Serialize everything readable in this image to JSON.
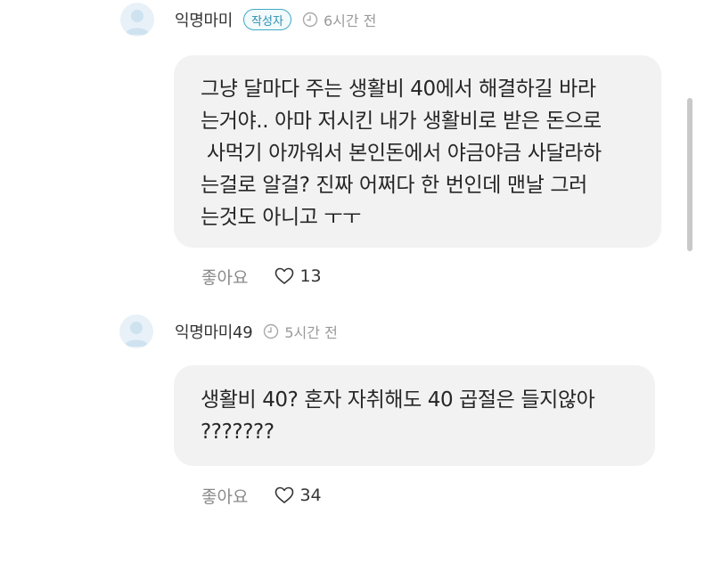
{
  "comments": [
    {
      "author": "익명마미",
      "badge": "작성자",
      "time": "6시간 전",
      "lines": [
        "그냥 달마다 주는 생활비 40에서 해결하길 바라",
        "는거야.. 아마 저시킨 내가 생활비로 받은 돈으로",
        " 사먹기 아까워서 본인돈에서 야금야금 사달라하",
        "는걸로 알걸? 진짜 어쩌다 한 번인데 맨날 그러",
        "는것도 아니고 ㅜㅜ"
      ],
      "like_label": "좋아요",
      "like_count": "13"
    },
    {
      "author": "익명마미49",
      "time": "5시간 전",
      "lines": [
        "생활비 40? 혼자 자취해도 40 곱절은 들지않아",
        "???????"
      ],
      "like_label": "좋아요",
      "like_count": "34"
    }
  ],
  "icons": {
    "avatar": "avatar-icon",
    "clock": "clock-icon",
    "heart": "heart-outline-icon"
  },
  "colors": {
    "bubble": "#f2f2f2",
    "badge_border": "#3fa9c5",
    "badge_text": "#2a8fae",
    "avatar_bg": "#e8f1f8",
    "avatar_fg": "#cfe2f0",
    "muted": "#9a9a9a"
  }
}
